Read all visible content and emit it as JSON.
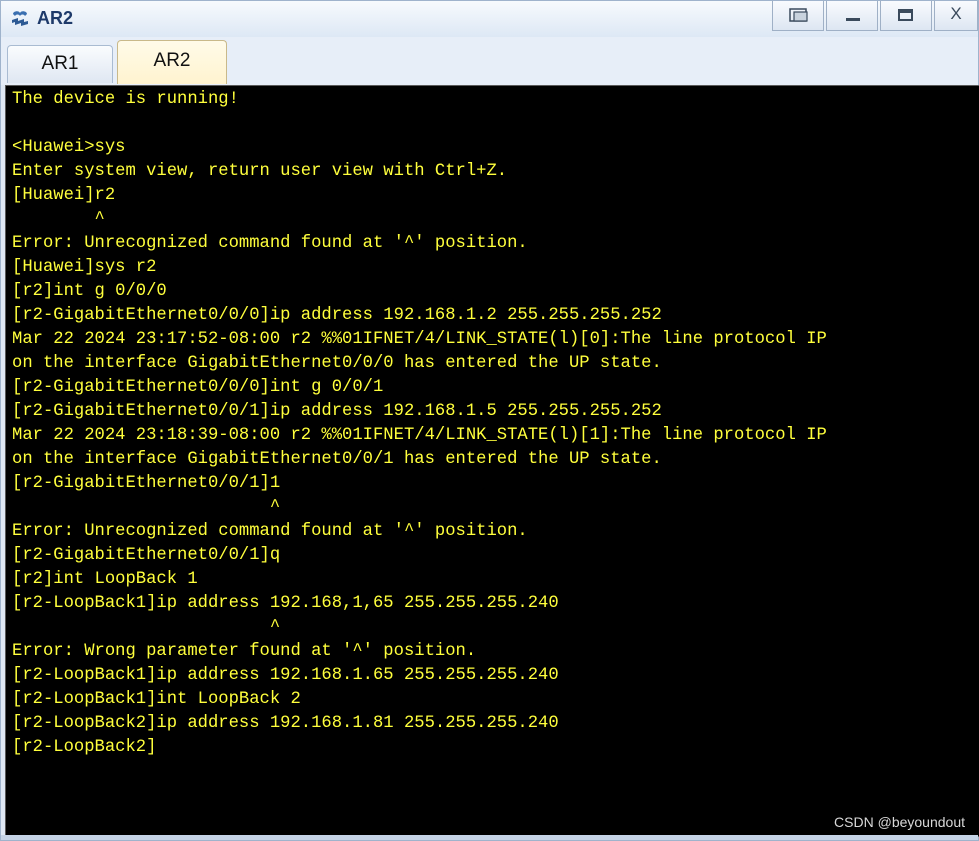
{
  "window": {
    "title": "AR2",
    "controls": {
      "restore_icon": "restore-icon",
      "minimize_label": "—",
      "maximize_icon": "maximize-icon",
      "close_label": "X"
    }
  },
  "tabs": [
    {
      "label": "AR1",
      "active": false
    },
    {
      "label": "AR2",
      "active": true
    }
  ],
  "terminal": {
    "text_color": "#ffff3c",
    "background": "#000000",
    "lines": [
      "The device is running!",
      "",
      "<Huawei>sys",
      "Enter system view, return user view with Ctrl+Z.",
      "[Huawei]r2",
      "        ^",
      "Error: Unrecognized command found at '^' position.",
      "[Huawei]sys r2",
      "[r2]int g 0/0/0",
      "[r2-GigabitEthernet0/0/0]ip address 192.168.1.2 255.255.255.252",
      "Mar 22 2024 23:17:52-08:00 r2 %%01IFNET/4/LINK_STATE(l)[0]:The line protocol IP",
      "on the interface GigabitEthernet0/0/0 has entered the UP state.",
      "[r2-GigabitEthernet0/0/0]int g 0/0/1",
      "[r2-GigabitEthernet0/0/1]ip address 192.168.1.5 255.255.255.252",
      "Mar 22 2024 23:18:39-08:00 r2 %%01IFNET/4/LINK_STATE(l)[1]:The line protocol IP",
      "on the interface GigabitEthernet0/0/1 has entered the UP state.",
      "[r2-GigabitEthernet0/0/1]1",
      "                         ^",
      "Error: Unrecognized command found at '^' position.",
      "[r2-GigabitEthernet0/0/1]q",
      "[r2]int LoopBack 1",
      "[r2-LoopBack1]ip address 192.168,1,65 255.255.255.240",
      "                         ^",
      "Error: Wrong parameter found at '^' position.",
      "[r2-LoopBack1]ip address 192.168.1.65 255.255.255.240",
      "[r2-LoopBack1]int LoopBack 2",
      "[r2-LoopBack2]ip address 192.168.1.81 255.255.255.240",
      "[r2-LoopBack2]"
    ]
  },
  "watermark": "CSDN @beyoundout"
}
